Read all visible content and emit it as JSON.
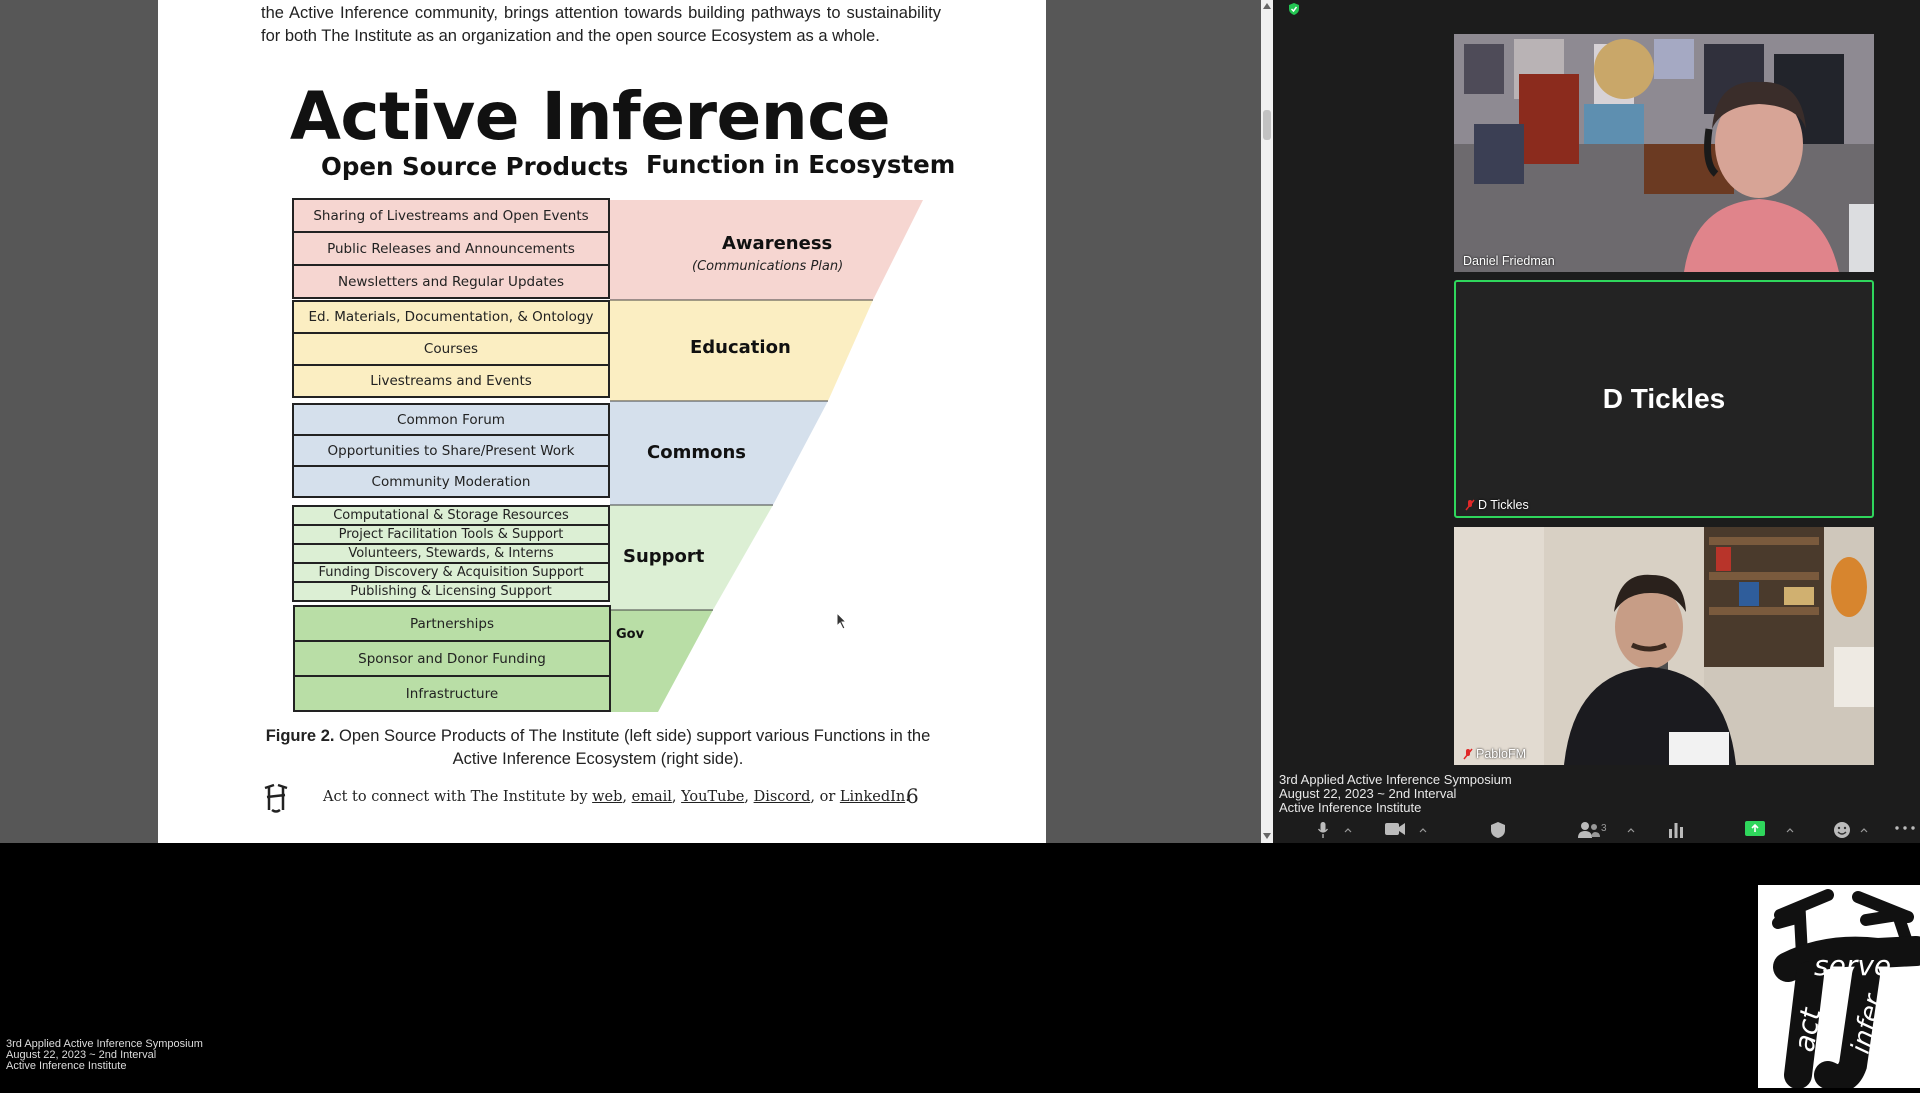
{
  "document": {
    "intro_text": "the Active Inference community, brings attention towards building pathways to sustainability for both The Institute as an organization and the open source Ecosystem as a whole.",
    "title": "Active Inference",
    "left_heading": "Open Source Products",
    "right_heading": "Function in Ecosystem",
    "groups": [
      {
        "function": "Awareness",
        "function_sub": "(Communications Plan)",
        "color": "#f6d6d1",
        "items": [
          "Sharing of Livestreams and Open Events",
          "Public Releases and Announcements",
          "Newsletters and Regular Updates"
        ]
      },
      {
        "function": "Education",
        "color": "#fbeec2",
        "items": [
          "Ed. Materials, Documentation, & Ontology",
          "Courses",
          "Livestreams and Events"
        ]
      },
      {
        "function": "Commons",
        "color": "#d5e0ec",
        "items": [
          "Common Forum",
          "Opportunities to Share/Present Work",
          "Community Moderation"
        ]
      },
      {
        "function": "Support",
        "color": "#dcefd4",
        "items": [
          "Computational & Storage Resources",
          "Project Facilitation Tools & Support",
          "Volunteers, Stewards, & Interns",
          "Funding Discovery & Acquisition Support",
          "Publishing & Licensing Support"
        ]
      },
      {
        "function": "Gov",
        "color": "#b9dea6",
        "items": [
          "Partnerships",
          "Sponsor and Donor Funding",
          "Infrastructure"
        ]
      }
    ],
    "caption_bold": "Figure 2.",
    "caption_text": " Open Source Products of The Institute (left side) support various Functions in the Active Inference Ecosystem (right side).",
    "footer": {
      "prefix": "Act to connect with The Institute by ",
      "link_web": "web",
      "sep1": ", ",
      "link_email": "email",
      "sep2": ", ",
      "link_youtube": "YouTube",
      "sep3": ", ",
      "link_discord": "Discord",
      "sep4": ", or ",
      "link_linkedin": "LinkedIn",
      "suffix": "."
    },
    "page_number": "6"
  },
  "meeting": {
    "participants": [
      {
        "name": "Daniel Friedman",
        "muted": false
      },
      {
        "name": "D Tickles",
        "display": "D Tickles",
        "muted": true,
        "active_speaker": true
      },
      {
        "name": "PabloFM",
        "muted": true
      }
    ],
    "session_info": [
      "3rd Applied Active Inference Symposium",
      "August 22, 2023 ~ 2nd Interval",
      "Active Inference Institute"
    ],
    "participant_count": "3",
    "accent_color": "#2fd65c"
  },
  "overlay": {
    "session_info": [
      "3rd Applied Active Inference Symposium",
      "August 22, 2023 ~ 2nd Interval",
      "Active Inference Institute"
    ],
    "logo_words": [
      "serve",
      "act",
      "infer"
    ]
  }
}
